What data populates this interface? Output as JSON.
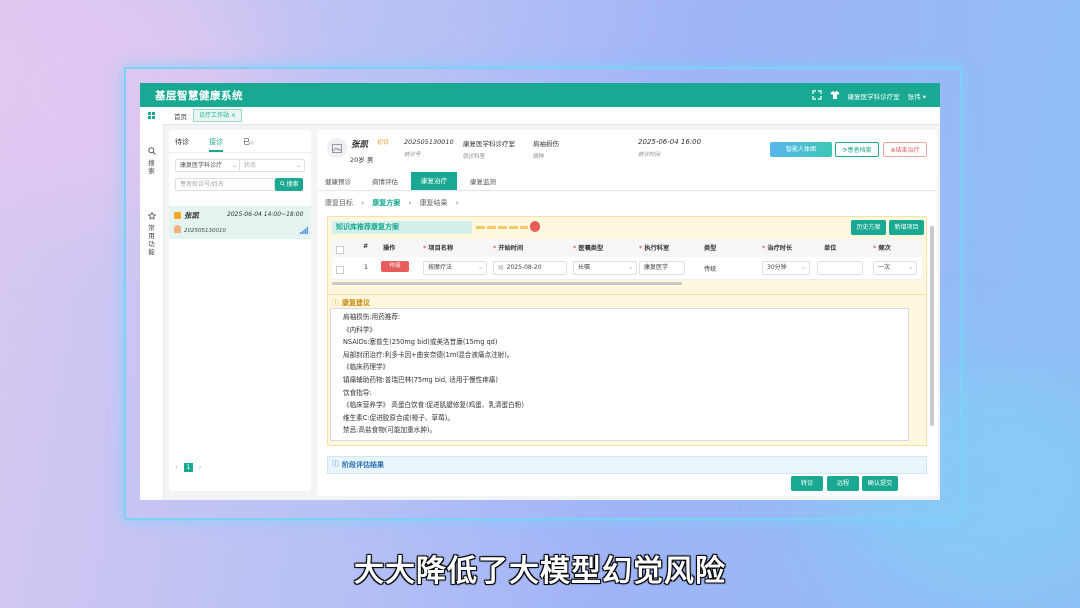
{
  "app": {
    "title": "基层智慧健康系统",
    "clinic": "康复医学科诊疗室",
    "user": "张伟"
  },
  "tabs": {
    "home": "首页",
    "active": "诊疗工作站",
    "active_close": "×"
  },
  "leftnav": {
    "search": "搜索",
    "common": "常用功能"
  },
  "patients": {
    "tabs": [
      "待诊",
      "接诊",
      "已"
    ],
    "tab3_suffix": "诊",
    "dept_select": "康复医学科诊疗",
    "status_placeholder": "状态",
    "search_placeholder": "患者就诊号/姓名",
    "search_button": "搜索",
    "current": {
      "name": "张凯",
      "time": "2025-06-04 14:00~18:00",
      "id": "202505130010"
    },
    "page": "1"
  },
  "header": {
    "name": "张凯",
    "visit_type": "初诊",
    "age_gender": "20岁  男",
    "visit_no": "202505130010",
    "visit_no_label": "就诊号",
    "dept": "康复医学科诊疗室",
    "dept_label": "就诊科室",
    "disease": "肩袖损伤",
    "disease_label": "病种",
    "visit_time": "2025-06-04 16:00",
    "visit_time_label": "就诊时间",
    "btn_body": "智能人体图",
    "btn_record": "患者档案",
    "btn_end": "结束治疗"
  },
  "section_tabs": [
    "健康预诊",
    "病情评估",
    "康复治疗",
    "康复监测"
  ],
  "crumbs": [
    "康复目标",
    "康复方案",
    "康复结果"
  ],
  "knowledge": {
    "title": "知识库推荐康复方案",
    "btn_history": "历史方案",
    "btn_add": "新增项目"
  },
  "table": {
    "headers": [
      "#",
      "操作",
      "项目名称",
      "开始时间",
      "医嘱类型",
      "执行科室",
      "类型",
      "治疗时长",
      "单位",
      "频次"
    ],
    "row": {
      "index": "1",
      "action": "作废",
      "name": "按摩疗法",
      "start": "2025-08-20",
      "order_type": "长嘱",
      "dept": "康复医学",
      "type": "传统",
      "duration": "30分钟",
      "unit": "",
      "freq": "一次"
    }
  },
  "advice": {
    "title": "康复建议",
    "lines": [
      "肩袖损伤:用药推荐:",
      "《内科学》",
      "NSAIDs:塞普生(250mg bid)或美洛昔康(15mg qd)",
      "局部封闭治疗:利多卡因+曲安奈德(1ml混合液痛点注射)。",
      "《临床药理学》",
      "镇痛辅助药物:普瑞巴林(75mg bid, 适用于慢性疼痛)",
      "饮食指导:",
      "《临床营养学》 高蛋白饮食:促进肌腱修复(鸡蛋、乳清蛋白粉)",
      "维生素C:促进胶原合成(橙子、草莓)。",
      "禁忌:高盐食物(可能加重水肿)。"
    ]
  },
  "stage": {
    "title": "阶段评估结果"
  },
  "footer": {
    "transfer": "转诊",
    "remote": "远程",
    "confirm": "确认提交"
  },
  "subtitle": "大大降低了大模型幻觉风险",
  "colors": {
    "primary": "#19a891",
    "danger": "#e85c5c",
    "panel": "#fff8df"
  }
}
